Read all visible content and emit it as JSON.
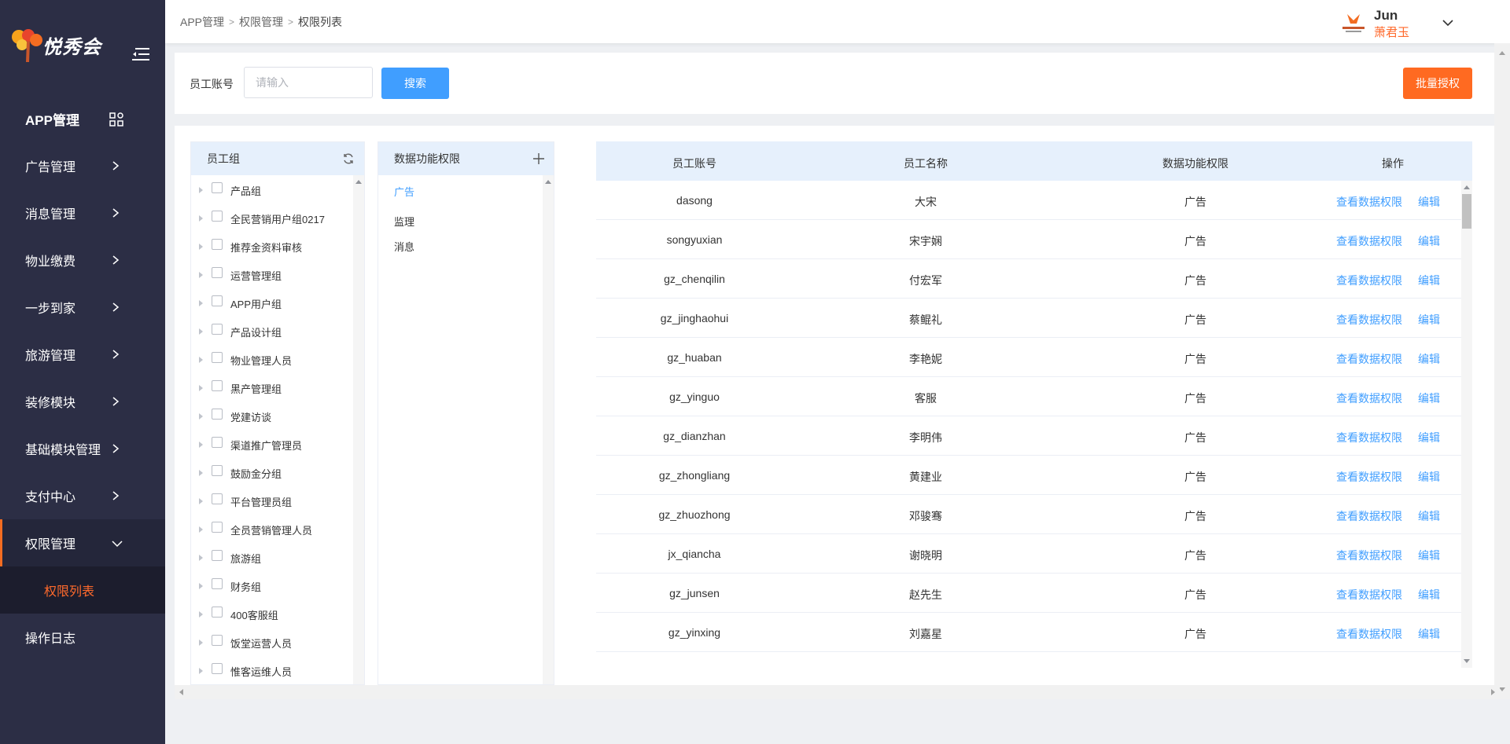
{
  "app": {
    "logo_text": "悦秀会",
    "accent_color": "#ff6a21",
    "primary_color": "#409eff",
    "sidebar_color": "#2c2e45"
  },
  "sidebar": {
    "top_item": {
      "label": "APP管理",
      "icon": "grid-apps-icon"
    },
    "items": [
      {
        "label": "广告管理",
        "icon": "chevron-right-icon"
      },
      {
        "label": "消息管理",
        "icon": "chevron-right-icon"
      },
      {
        "label": "物业缴费",
        "icon": "chevron-right-icon"
      },
      {
        "label": "一步到家",
        "icon": "chevron-right-icon"
      },
      {
        "label": "旅游管理",
        "icon": "chevron-right-icon"
      },
      {
        "label": "装修模块",
        "icon": "chevron-right-icon"
      },
      {
        "label": "基础模块管理",
        "icon": "chevron-right-icon"
      },
      {
        "label": "支付中心",
        "icon": "chevron-right-icon"
      }
    ],
    "active_item": {
      "label": "权限管理",
      "icon": "chevron-down-icon"
    },
    "active_sub": {
      "label": "权限列表"
    },
    "bottom_item": {
      "label": "操作日志"
    }
  },
  "header": {
    "breadcrumb": [
      "APP管理",
      "权限管理",
      "权限列表"
    ],
    "user": {
      "name": "Jun",
      "display_name": "萧君玉",
      "avatar_icon": "company-logo-icon"
    }
  },
  "search": {
    "label": "员工账号",
    "placeholder": "请输入",
    "value": "",
    "search_label": "搜索",
    "batch_label": "批量授权"
  },
  "groups": {
    "title": "员工组",
    "items": [
      "产品组",
      "全民营销用户组0217",
      "推荐金资料审核",
      "运营管理组",
      "APP用户组",
      "产品设计组",
      "物业管理人员",
      "黑产管理组",
      "党建访谈",
      "渠道推广管理员",
      "鼓励金分组",
      "平台管理员组",
      "全员营销管理人员",
      "旅游组",
      "财务组",
      "400客服组",
      "饭堂运营人员",
      "惟客运维人员"
    ]
  },
  "functions": {
    "title": "数据功能权限",
    "items": [
      "广告",
      "监理",
      "消息"
    ],
    "selected": "广告"
  },
  "table": {
    "columns": [
      "员工账号",
      "员工名称",
      "数据功能权限",
      "操作"
    ],
    "action_view": "查看数据权限",
    "action_edit": "编辑",
    "rows": [
      {
        "account": "dasong",
        "name": "大宋",
        "perm": "广告"
      },
      {
        "account": "songyuxian",
        "name": "宋宇娴",
        "perm": "广告"
      },
      {
        "account": "gz_chenqilin",
        "name": "付宏军",
        "perm": "广告"
      },
      {
        "account": "gz_jinghaohui",
        "name": "蔡鲲礼",
        "perm": "广告"
      },
      {
        "account": "gz_huaban",
        "name": "李艳妮",
        "perm": "广告"
      },
      {
        "account": "gz_yinguo",
        "name": "客服",
        "perm": "广告"
      },
      {
        "account": "gz_dianzhan",
        "name": "李明伟",
        "perm": "广告"
      },
      {
        "account": "gz_zhongliang",
        "name": "黄建业",
        "perm": "广告"
      },
      {
        "account": "gz_zhuozhong",
        "name": "邓骏骞",
        "perm": "广告"
      },
      {
        "account": "jx_qiancha",
        "name": "谢晓明",
        "perm": "广告"
      },
      {
        "account": "gz_junsen",
        "name": "赵先生",
        "perm": "广告"
      },
      {
        "account": "gz_yinxing",
        "name": "刘嘉星",
        "perm": "广告"
      }
    ]
  }
}
